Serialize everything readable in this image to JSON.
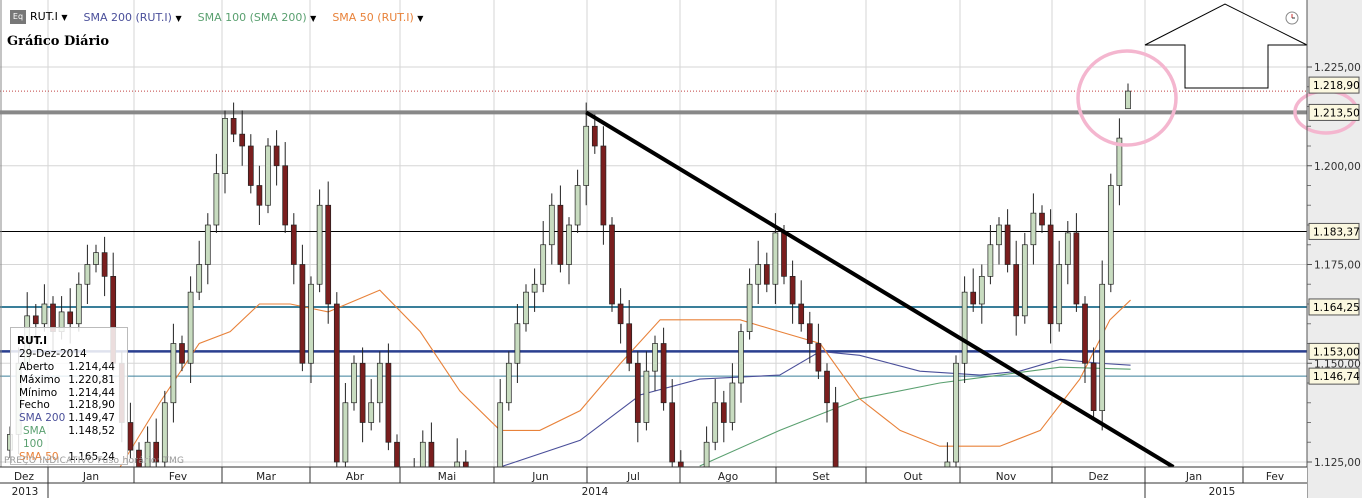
{
  "legend": {
    "symbol": "RUT.I",
    "sma200": "SMA 200 (RUT.I)",
    "sma100": "SMA 100 (SMA 200)",
    "sma50": "SMA 50 (RUT.I)",
    "dropdown_glyph": "▼"
  },
  "title": "Gráfico Diário",
  "info_box": {
    "symbol": "RUT.I",
    "date": "29-Dez-2014",
    "rows": [
      {
        "label": "Aberto",
        "value": "1.214,44"
      },
      {
        "label": "Máximo",
        "value": "1.220,81"
      },
      {
        "label": "Mínimo",
        "value": "1.214,44"
      },
      {
        "label": "Fecho",
        "value": "1.218,90"
      },
      {
        "label": "SMA 200",
        "value": "1.149,47"
      },
      {
        "label": "SMA 100",
        "value": "1.148,52"
      },
      {
        "label": "SMA 50",
        "value": "1.165,24"
      }
    ]
  },
  "footer": "PREÇO INDICATIVO   Fuso horário: TMG",
  "colors": {
    "up": "#c8dcc0",
    "down": "#7a1e1e",
    "sma200": "#4a4f9a",
    "sma100": "#5aa070",
    "sma50": "#e8823a",
    "teal": "#3a7f9a",
    "navy": "#2a3f8f",
    "pink": "#f4b6cf"
  },
  "chart_data": {
    "type": "candlestick",
    "title": "Gráfico Diário",
    "symbol": "RUT.I",
    "ylim": [
      1125,
      1225
    ],
    "y_ticks": [
      {
        "value": 1225,
        "label": "1.225,00"
      },
      {
        "value": 1200,
        "label": "1.200,00"
      },
      {
        "value": 1175,
        "label": "1.175,00"
      },
      {
        "value": 1150,
        "label": "1.150,00"
      },
      {
        "value": 1125,
        "label": "1.125,00"
      }
    ],
    "months": [
      "Dez",
      "Jan",
      "Fev",
      "Mar",
      "Abr",
      "Mai",
      "Jun",
      "Jul",
      "Ago",
      "Set",
      "Out",
      "Nov",
      "Dez",
      "Jan",
      "Fev"
    ],
    "years": [
      "2013",
      "2014",
      "2015"
    ],
    "closes": [
      1132,
      1150,
      1162,
      1160,
      1165,
      1158,
      1163,
      1160,
      1170,
      1175,
      1178,
      1172,
      1150,
      1135,
      1128,
      1120,
      1130,
      1125,
      1140,
      1155,
      1150,
      1168,
      1175,
      1185,
      1198,
      1212,
      1208,
      1205,
      1195,
      1190,
      1205,
      1200,
      1185,
      1175,
      1150,
      1170,
      1190,
      1165,
      1125,
      1140,
      1150,
      1135,
      1140,
      1150,
      1130,
      1115,
      1108,
      1120,
      1130,
      1115,
      1110,
      1118,
      1125,
      1112,
      1105,
      1110,
      1115,
      1140,
      1150,
      1160,
      1168,
      1170,
      1180,
      1190,
      1175,
      1185,
      1195,
      1210,
      1205,
      1185,
      1165,
      1160,
      1150,
      1135,
      1148,
      1155,
      1140,
      1125,
      1115,
      1110,
      1120,
      1130,
      1140,
      1135,
      1145,
      1158,
      1170,
      1175,
      1170,
      1183,
      1172,
      1165,
      1160,
      1155,
      1148,
      1140,
      1115,
      1105,
      1100,
      1098,
      1095,
      1100,
      1098,
      1102,
      1100,
      1105,
      1100,
      1105,
      1110,
      1125,
      1150,
      1168,
      1165,
      1172,
      1180,
      1185,
      1175,
      1162,
      1180,
      1188,
      1185,
      1160,
      1175,
      1183,
      1165,
      1150,
      1138,
      1170,
      1195,
      1207,
      1218.9
    ],
    "last_candle": {
      "open": 1214.44,
      "high": 1220.81,
      "low": 1214.44,
      "close": 1218.9
    },
    "sma50": [
      [
        12.8,
        1122
      ],
      [
        17.4,
        1140
      ],
      [
        22,
        1155
      ],
      [
        25.6,
        1158
      ],
      [
        29,
        1165
      ],
      [
        32.6,
        1165
      ],
      [
        37,
        1163
      ],
      [
        43,
        1168.5
      ],
      [
        47.7,
        1158
      ],
      [
        52.3,
        1143
      ],
      [
        57,
        1133
      ],
      [
        61.6,
        1133
      ],
      [
        66.3,
        1138
      ],
      [
        71,
        1150
      ],
      [
        75.6,
        1161
      ],
      [
        80.2,
        1161
      ],
      [
        84.9,
        1161
      ],
      [
        89.5,
        1158
      ],
      [
        94.2,
        1155
      ],
      [
        98.8,
        1141
      ],
      [
        103.5,
        1133
      ],
      [
        108.1,
        1129
      ],
      [
        115.1,
        1129
      ],
      [
        119.8,
        1133
      ],
      [
        124.4,
        1146
      ],
      [
        127.9,
        1161
      ],
      [
        130.3,
        1166
      ]
    ],
    "sma200": [
      [
        57,
        1123.5
      ],
      [
        66.3,
        1130.5
      ],
      [
        73.3,
        1142
      ],
      [
        80.2,
        1146
      ],
      [
        89.5,
        1147
      ],
      [
        94.2,
        1153
      ],
      [
        98.8,
        1152
      ],
      [
        105.8,
        1148
      ],
      [
        112.8,
        1147
      ],
      [
        117.4,
        1148
      ],
      [
        122.1,
        1151
      ],
      [
        126.7,
        1150
      ],
      [
        130.3,
        1149.5
      ]
    ],
    "sma100": [
      [
        80.2,
        1124
      ],
      [
        89.5,
        1133
      ],
      [
        98.8,
        1141
      ],
      [
        108.1,
        1145
      ],
      [
        115.1,
        1147
      ],
      [
        122.1,
        1149
      ],
      [
        130.3,
        1148.5
      ]
    ],
    "levels": [
      {
        "value": 1218.9,
        "label": "1.218,90",
        "style": "dotted-red"
      },
      {
        "value": 1213.5,
        "label": "1.213,50",
        "style": "thick-gray"
      },
      {
        "value": 1183.37,
        "label": "1.183,37",
        "style": "black"
      },
      {
        "value": 1164.25,
        "label": "1.164,25",
        "style": "teal"
      },
      {
        "value": 1153.0,
        "label": "1.153,00",
        "style": "navy"
      },
      {
        "value": 1146.74,
        "label": "1.146,74",
        "style": "thin-teal"
      }
    ],
    "trendline": {
      "from": [
        67,
        1213.5
      ],
      "to": [
        136.6,
        1122
      ]
    }
  }
}
